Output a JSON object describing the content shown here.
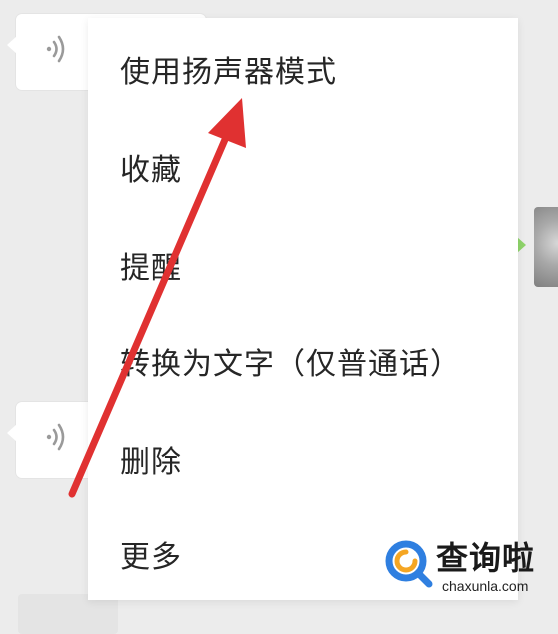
{
  "context_menu": {
    "items": [
      {
        "label": "使用扬声器模式"
      },
      {
        "label": "收藏"
      },
      {
        "label": "提醒"
      },
      {
        "label": "转换为文字（仅普通话）"
      },
      {
        "label": "删除"
      },
      {
        "label": "更多"
      }
    ]
  },
  "chat": {
    "voice_icon": "voice-wave-icon",
    "colors": {
      "background": "#ececec",
      "bubble": "#ffffff",
      "sent_bubble": "#8ed36a"
    }
  },
  "annotation": {
    "arrow_color": "#e03131"
  },
  "watermark": {
    "title": "查询啦",
    "domain": "chaxunla.com",
    "logo_colors": [
      "#2f7fe0",
      "#f5a623"
    ]
  }
}
